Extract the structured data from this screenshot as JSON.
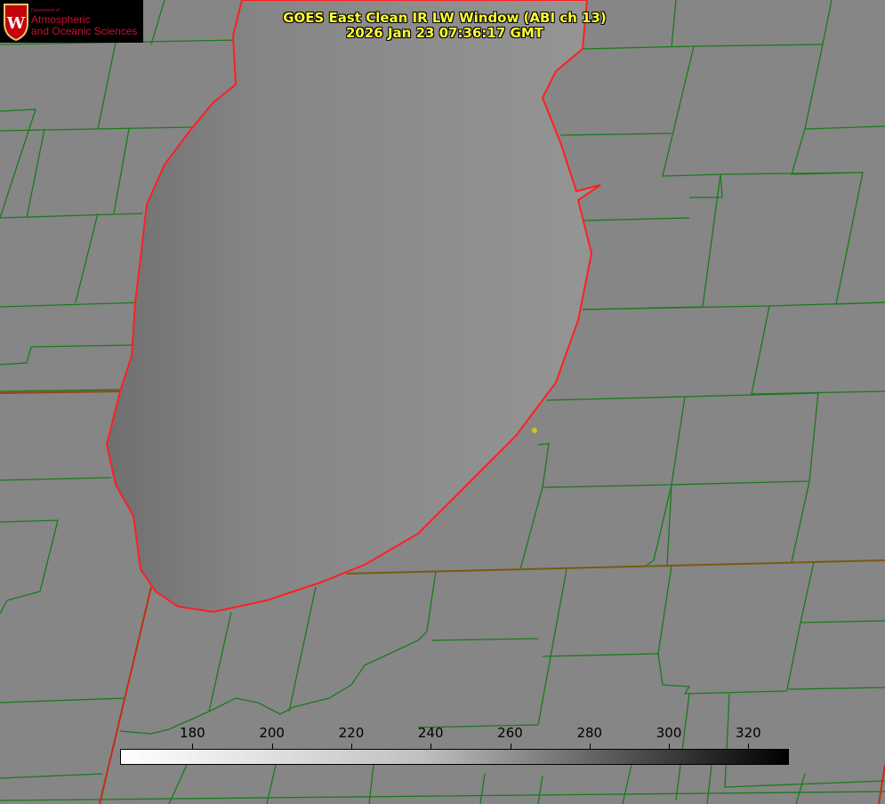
{
  "logo": {
    "line1": "Department of",
    "line2": "Atmospheric",
    "line3": "and Oceanic Sciences",
    "emblem_letter": "W"
  },
  "title": {
    "line1": "GOES East Clean IR LW Window (ABI ch 13)",
    "line2": "2026 Jan 23 07:36:17 GMT"
  },
  "colorbar": {
    "min": 162,
    "max": 330,
    "ticks": [
      "180",
      "200",
      "220",
      "240",
      "260",
      "280",
      "300",
      "320"
    ]
  },
  "colors": {
    "title": "#ffff33",
    "lake_outline": "#ff2020",
    "county_lines": "#1a7a1a"
  }
}
